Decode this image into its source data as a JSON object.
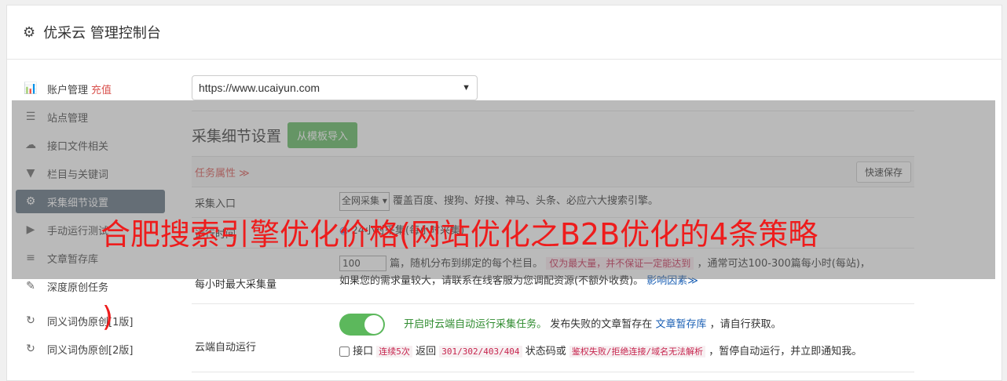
{
  "header": {
    "title": "优采云 管理控制台",
    "icon": "gear-icon"
  },
  "sidebar": {
    "items": [
      {
        "label": "账户管理",
        "extra": "充值",
        "icon": "bar-chart-icon"
      },
      {
        "label": "站点管理",
        "icon": "server-icon"
      },
      {
        "label": "接口文件相关",
        "icon": "cloud-upload-icon"
      },
      {
        "label": "栏目与关键词",
        "icon": "filter-icon"
      },
      {
        "label": "采集细节设置",
        "icon": "cogs-icon",
        "active": true
      },
      {
        "label": "手动运行测试",
        "icon": "play-icon"
      },
      {
        "label": "文章暂存库",
        "icon": "database-icon"
      },
      {
        "label": "深度原创任务",
        "icon": "edit-icon"
      },
      {
        "label": "同义词伪原创[1版]",
        "icon": "refresh-icon"
      },
      {
        "label": "同义词伪原创[2版]",
        "icon": "refresh-icon"
      }
    ]
  },
  "main": {
    "site_select": "https://www.ucaiyun.com",
    "section_title": "采集细节设置",
    "import_button": "从模板导入",
    "task_title": "任务属性 ≫",
    "quick_save": "快速保存",
    "rows": {
      "entry_label": "采集入口",
      "entry_select": "全网采集",
      "entry_desc": "覆盖百度、搜狗、好搜、神马、头条、必应六大搜索引擎。",
      "time_label": "运行时间",
      "time_desc": "24小时采集(每小时采集)",
      "max_label": "每小时最大采集量",
      "max_value": "100",
      "max_desc1": "篇，随机分布到绑定的每个栏目。",
      "max_tag": "仅为最大量，并不保证一定能达到",
      "max_desc2": "，通常可达100-300篇每小时(每站)，",
      "max_desc3": "如果您的需求量较大，请联系在线客服为您调配资源(不额外收费)。",
      "max_link": "影响因素≫",
      "cloud_label": "云端自动运行",
      "cloud_green": "开启时云端自动运行采集任务。",
      "cloud_desc1": "发布失败的文章暂存在",
      "cloud_link": "文章暂存库",
      "cloud_desc2": "，请自行获取。",
      "iface_prefix": "接口",
      "iface_tag1": "连续5次",
      "iface_mid1": "返回",
      "iface_code": "301/302/403/404",
      "iface_mid2": "状态码或",
      "iface_tag2": "鉴权失败/拒绝连接/域名无法解析",
      "iface_end": "，暂停自动运行，并立即通知我。"
    }
  },
  "overlay": {
    "title": "合肥搜索引擎优化价格(网站优化之B2B优化的4条策略",
    "paren": ")"
  }
}
